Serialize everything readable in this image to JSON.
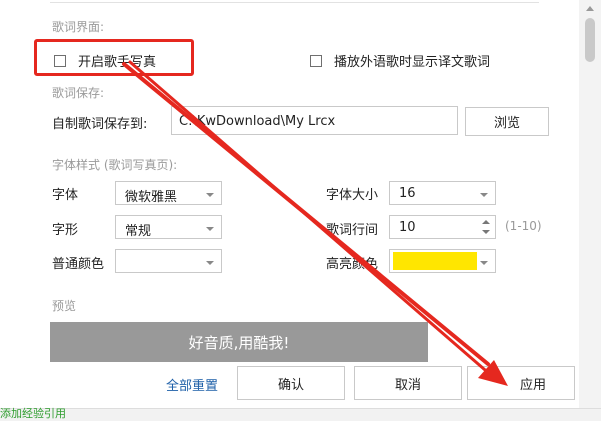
{
  "lyrics_ui": {
    "section_title": "歌词界面:",
    "enable_artist_photo": {
      "label": "开启歌手写真",
      "checked": false
    },
    "show_translation": {
      "label": "播放外语歌时显示译文歌词",
      "checked": false
    }
  },
  "lyrics_save": {
    "section_title": "歌词保存:",
    "path_label": "自制歌词保存到:",
    "path_value": "C:\\KwDownload\\My Lrcx",
    "browse_label": "浏览"
  },
  "font_style": {
    "section_title": "字体样式 (歌词写真页):",
    "font_label": "字体",
    "font_value": "微软雅黑",
    "size_label": "字体大小",
    "size_value": "16",
    "shape_label": "字形",
    "shape_value": "常规",
    "spacing_label": "歌词行间",
    "spacing_value": "10",
    "spacing_range": "(1-10)",
    "normal_color_label": "普通颜色",
    "normal_color": "#ffffff",
    "highlight_color_label": "高亮颜色",
    "highlight_color": "#ffe600"
  },
  "preview": {
    "section_title": "预览",
    "text": "好音质,用酷我!",
    "background": "#999999"
  },
  "footer": {
    "reset_label": "全部重置",
    "ok_label": "确认",
    "cancel_label": "取消",
    "apply_label": "应用",
    "bottom_left_text": "添加经验引用"
  },
  "annotation": {
    "highlight_color": "#e5281f",
    "arrow_color": "#e5281f"
  }
}
